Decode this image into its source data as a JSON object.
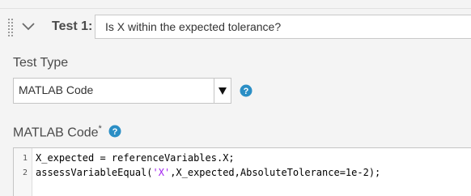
{
  "header": {
    "test_label": "Test 1:",
    "test_title_value": "Is X within the expected tolerance?",
    "icons": {
      "grip": "drag-grip-icon",
      "chevron": "chevron-down-icon"
    }
  },
  "test_type": {
    "label": "Test Type",
    "selected_value": "MATLAB Code",
    "help_icon": "help-icon"
  },
  "matlab_code": {
    "label": "MATLAB Code",
    "required_marker": "*",
    "help_icon": "help-icon",
    "lines": [
      {
        "number": "1",
        "code": "X_expected = referenceVariables.X;"
      },
      {
        "number": "2",
        "code_before": "assessVariableEqual(",
        "code_string": "'X'",
        "code_after": ",X_expected,AbsoluteTolerance=1e-2);"
      }
    ]
  },
  "colors": {
    "accent_help": "#2a8ec5",
    "string_literal": "#a020f0",
    "background": "#f4f4f4"
  }
}
